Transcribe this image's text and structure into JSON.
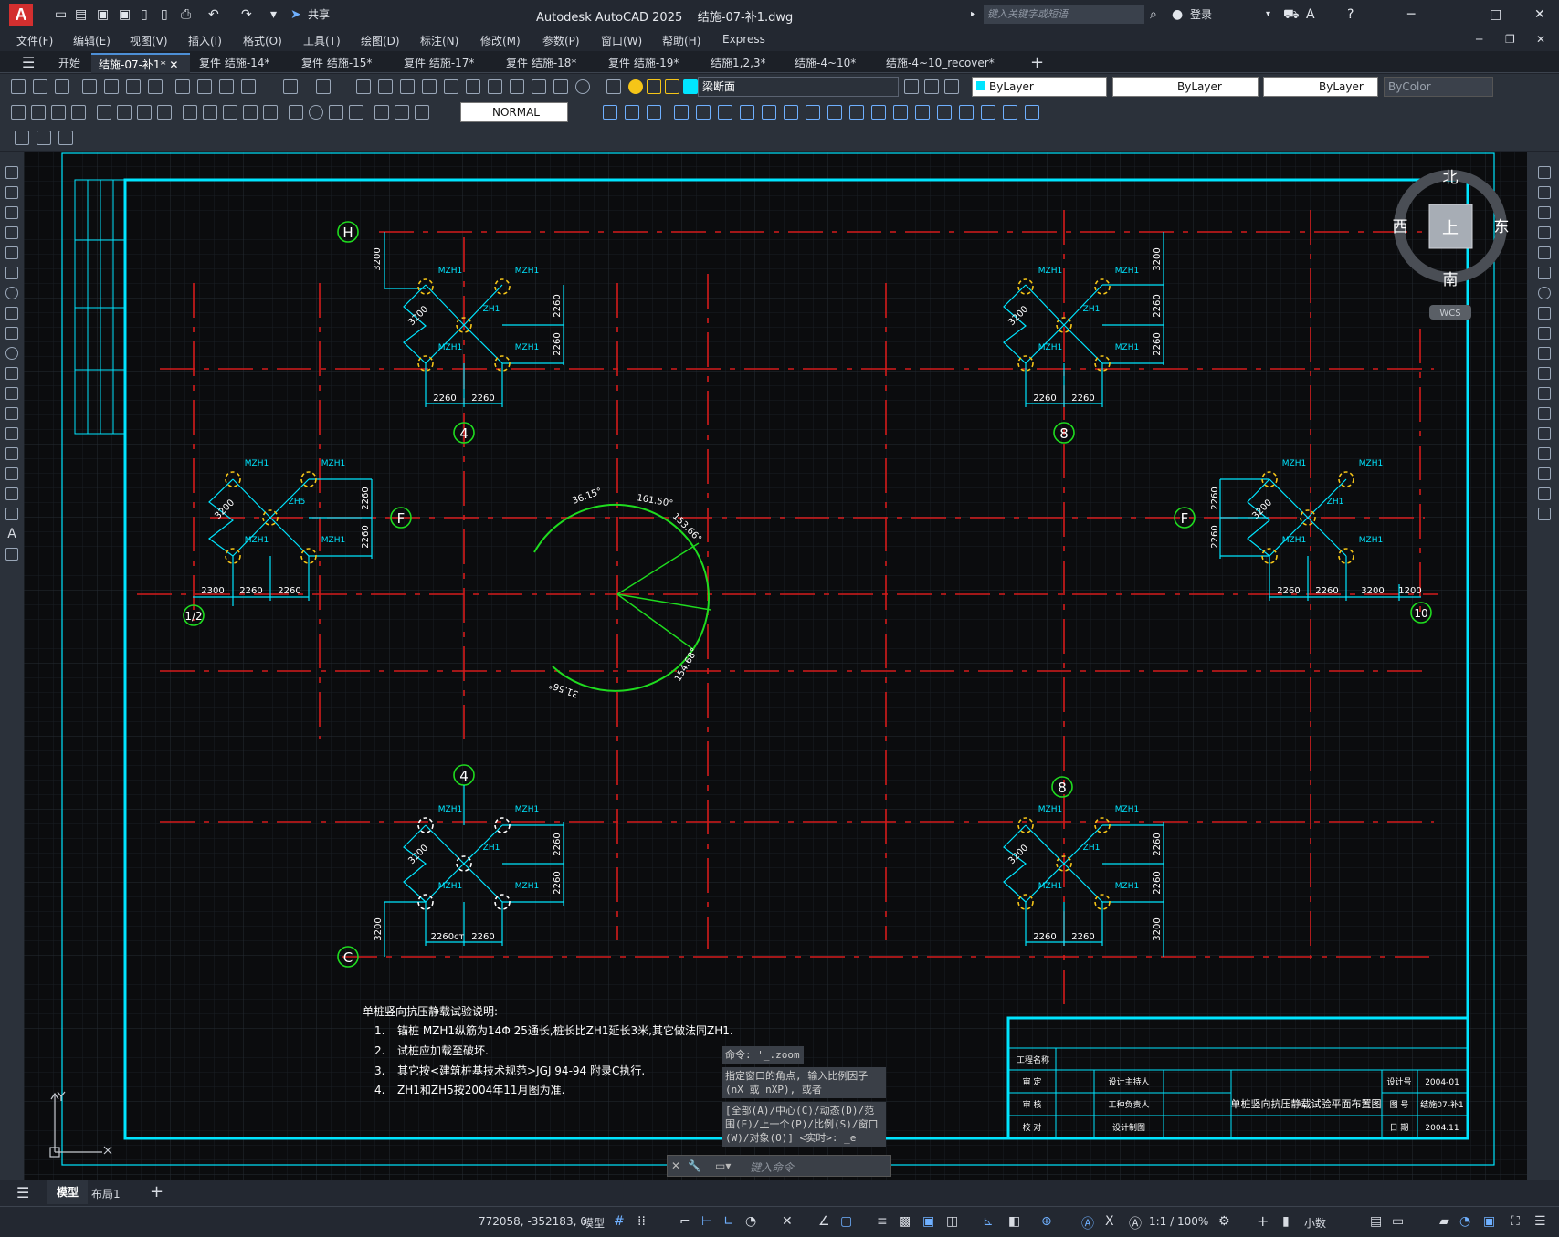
{
  "titlebar": {
    "app_title": "Autodesk AutoCAD 2025",
    "file_name": "结施-07-补1.dwg",
    "share_label": "共享",
    "search_placeholder": "键入关键字或短语",
    "login_label": "登录"
  },
  "menu": [
    "文件(F)",
    "编辑(E)",
    "视图(V)",
    "插入(I)",
    "格式(O)",
    "工具(T)",
    "绘图(D)",
    "标注(N)",
    "修改(M)",
    "参数(P)",
    "窗口(W)",
    "帮助(H)",
    "Express"
  ],
  "doc_tabs": [
    "开始",
    "结施-07-补1*",
    "复件 结施-14*",
    "复件 结施-15*",
    "复件 结施-17*",
    "复件 结施-18*",
    "复件 结施-19*",
    "结施1,2,3*",
    "结施-4~10*",
    "结施-4~10_recover*"
  ],
  "toolbar": {
    "layer_name": "梁断面",
    "color": "ByLayer",
    "linetype": "ByLayer",
    "lineweight": "ByLayer",
    "plotstyle": "ByColor",
    "text_style": "NORMAL"
  },
  "viewcube": {
    "north": "北",
    "south": "南",
    "east": "东",
    "west": "西",
    "top": "上",
    "wcs": "WCS"
  },
  "drawing": {
    "axis_labels": {
      "H": "H",
      "C": "C",
      "F_left": "F",
      "F_right": "F",
      "n4_top": "4",
      "n8_top": "8",
      "n4_bottom": "4",
      "n8_bottom": "8",
      "n1_2": "1/2",
      "n10": "10"
    },
    "pile_mzh": "MZH1",
    "pile_zh1": "ZH1",
    "pile_zh5": "ZH5",
    "dims": {
      "d3200": "3200",
      "d2260": "2260",
      "d2300": "2300",
      "d1200": "1200",
      "d2260c": "2260ст"
    },
    "arc_labels": [
      "36.15°",
      "161.50°",
      "153.66°",
      "154.68°",
      "31.56°"
    ],
    "notes_title": "单桩竖向抗压静载试验说明:",
    "notes": [
      {
        "n": "1.",
        "text": "锚桩 MZH1纵筋为14Φ 25通长,桩长比ZH1延长3米,其它做法同ZH1."
      },
      {
        "n": "2.",
        "text": "试桩应加载至破坏."
      },
      {
        "n": "3.",
        "text": "其它按<建筑桩基技术规范>JGJ 94-94 附录C执行."
      },
      {
        "n": "4.",
        "text": "ZH1和ZH5按2004年11月图为准."
      }
    ],
    "title_block": {
      "project_name": "工程名称",
      "approve": "审 定",
      "review": "审 核",
      "check": "校 对",
      "design_lead": "设计主持人",
      "eng_lead": "工种负责人",
      "designer": "设计制图",
      "drawing_title": "单桩竖向抗压静载试验平面布置图",
      "design_no_label": "设计号",
      "design_no": "2004-01",
      "drawing_no_label": "图 号",
      "drawing_no": "结施07-补1",
      "date_label": "日 期",
      "date": "2004.11"
    }
  },
  "command": {
    "history": [
      "命令: '_.zoom",
      "指定窗口的角点, 输入比例因子 (nX 或 nXP), 或者",
      "[全部(A)/中心(C)/动态(D)/范围(E)/上一个(P)/比例(S)/窗口(W)/对象(O)] <实时>: _e"
    ],
    "input_placeholder": "键入命令"
  },
  "layout_tabs": [
    "模型",
    "布局1"
  ],
  "status": {
    "coords": "772058, -352183, 0",
    "model": "模型",
    "scale": "1:1 / 100%",
    "units": "小数"
  }
}
